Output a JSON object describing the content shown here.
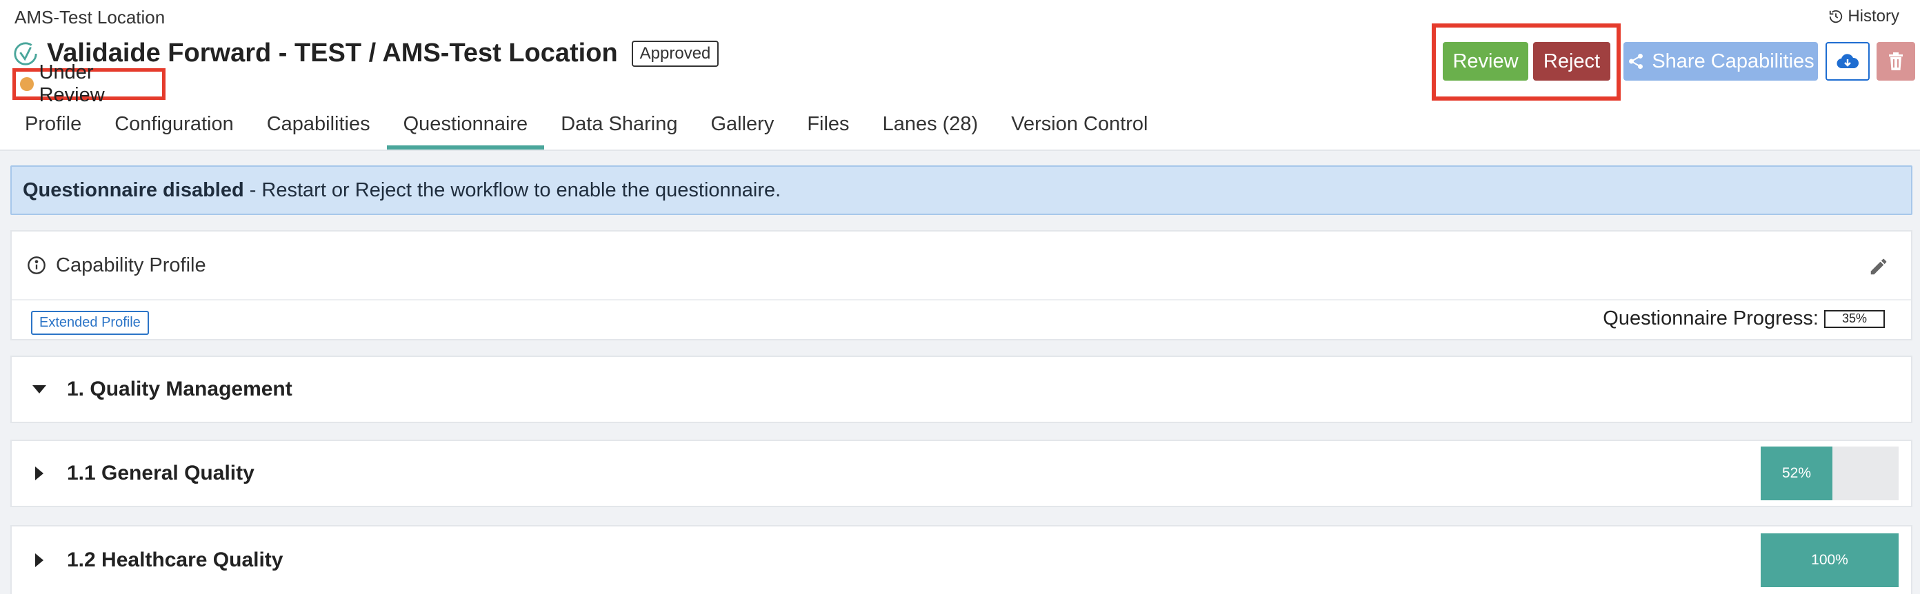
{
  "breadcrumb": "AMS-Test Location",
  "history_label": "History",
  "title": "Validaide Forward - TEST / AMS-Test Location",
  "approved_badge": "Approved",
  "status": {
    "label": "Under Review",
    "color": "#e9a54d"
  },
  "actions": {
    "review": "Review",
    "reject": "Reject",
    "share": "Share Capabilities",
    "download_icon": "cloud-download-icon",
    "delete_icon": "trash-icon"
  },
  "tabs": [
    {
      "label": "Profile"
    },
    {
      "label": "Configuration"
    },
    {
      "label": "Capabilities"
    },
    {
      "label": "Questionnaire",
      "active": true
    },
    {
      "label": "Data Sharing"
    },
    {
      "label": "Gallery"
    },
    {
      "label": "Files"
    },
    {
      "label": "Lanes (28)"
    },
    {
      "label": "Version Control"
    }
  ],
  "alert": {
    "strong": "Questionnaire disabled",
    "text": "- Restart or Reject the workflow to enable the questionnaire."
  },
  "capability_profile": {
    "title": "Capability Profile",
    "badge": "Extended Profile",
    "progress_label": "Questionnaire Progress:",
    "progress_value": "35%"
  },
  "sections": [
    {
      "title": "1. Quality Management",
      "expanded": true
    },
    {
      "title": "1.1 General Quality",
      "expanded": false,
      "progress": 52,
      "progress_label": "52%"
    },
    {
      "title": "1.2 Healthcare Quality",
      "expanded": false,
      "progress": 100,
      "progress_label": "100%"
    }
  ],
  "colors": {
    "accent": "#4aa69b",
    "review": "#6ab04c",
    "reject": "#a04040",
    "share": "#8fb4e8",
    "highlight": "#e53b2c"
  }
}
